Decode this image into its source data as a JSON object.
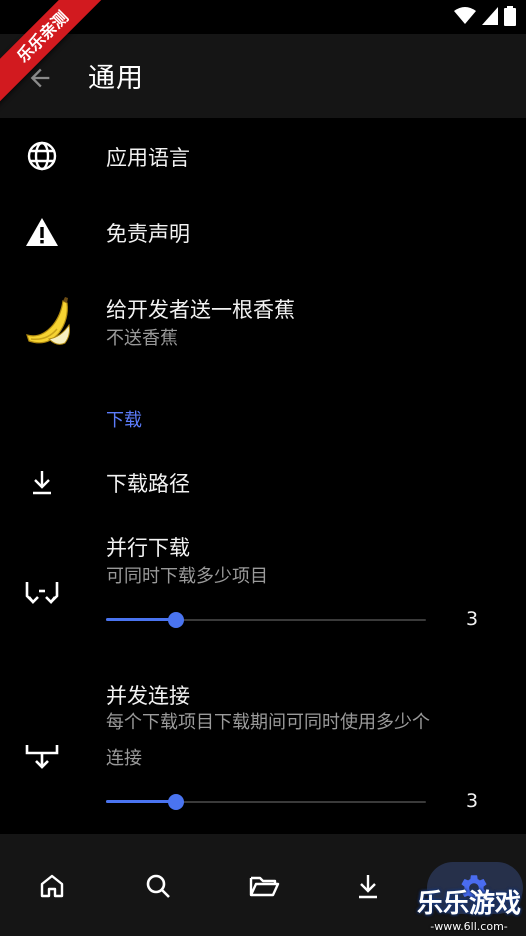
{
  "watermark": {
    "ribbon_text": "乐乐亲测",
    "brand": "乐乐游戏",
    "url": "-www.6ll.com-"
  },
  "app_bar": {
    "title": "通用"
  },
  "items": {
    "app_language": {
      "title": "应用语言",
      "icon": "globe-icon"
    },
    "disclaimer": {
      "title": "免责声明",
      "icon": "warning-icon"
    },
    "banana": {
      "title": "给开发者送一根香蕉",
      "subtitle": "不送香蕉",
      "icon": "banana-icon"
    }
  },
  "download_section": {
    "header": "下载",
    "path": {
      "title": "下载路径",
      "icon": "download-icon"
    },
    "parallel": {
      "title": "并行下载",
      "subtitle": "可同时下载多少项目",
      "value": "3",
      "level": 0.22,
      "icon": "parallel-download-icon"
    },
    "concurrent": {
      "title": "并发连接",
      "subtitle_line1": "每个下载项目下载期间可同时使用多少个",
      "subtitle_line2": "连接",
      "value": "3",
      "level": 0.22,
      "icon": "concurrent-connection-icon"
    }
  },
  "bottom_nav": {
    "items": [
      "home-icon",
      "search-icon",
      "folder-icon",
      "download-icon",
      "settings-icon"
    ],
    "selected": "settings-icon"
  },
  "colors": {
    "accent": "#4a74f0",
    "section_header": "#5c7cfa",
    "app_bar_bg": "#151515",
    "ribbon": "#d21a1f"
  }
}
